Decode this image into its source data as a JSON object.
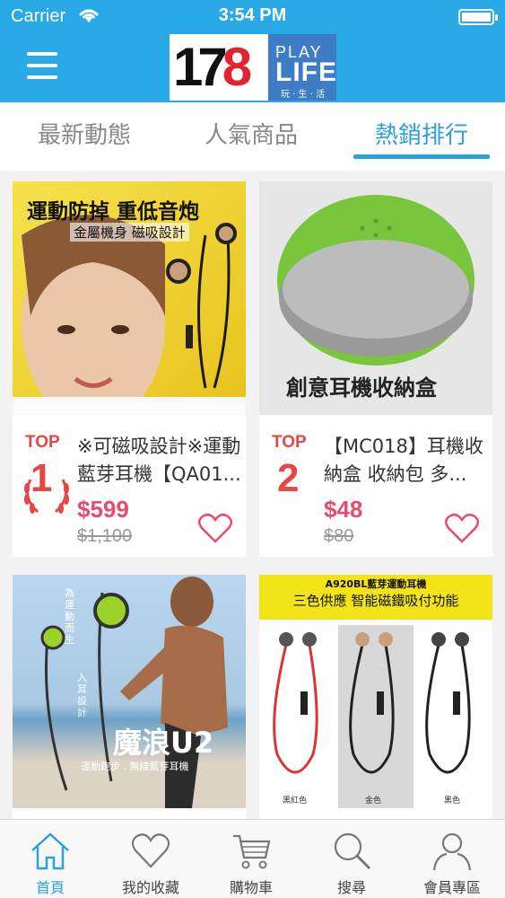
{
  "status_bar": {
    "carrier": "Carrier",
    "time": "3:54 PM",
    "battery_level": 1.0
  },
  "header": {
    "logo": {
      "number_left": "17",
      "number_right": "8",
      "play": "PLAY",
      "life": "LIFE",
      "chinese": "玩 · 生 · 活"
    },
    "icons": {
      "menu": "menu-icon",
      "wifi": "wifi-icon",
      "battery": "battery-icon"
    }
  },
  "tabs": [
    {
      "label": "最新動態",
      "active": false
    },
    {
      "label": "人氣商品",
      "active": false
    },
    {
      "label": "熱銷排行",
      "active": true
    }
  ],
  "products": [
    {
      "rank_label": "TOP",
      "rank": "1",
      "title": "※可磁吸設計※運動藍芽耳機【QA01...",
      "price": "$599",
      "original_price": "$1,100",
      "image_text": {
        "headline": "運動防掉 重低音炮",
        "sub": "金屬機身 磁吸設計"
      }
    },
    {
      "rank_label": "TOP",
      "rank": "2",
      "title": "【MC018】耳機收納盒 收納包 多...",
      "price": "$48",
      "original_price": "$80",
      "image_text": {
        "headline": "創意耳機收納盒"
      }
    },
    {
      "image_text": {
        "brand": "魔浪U2",
        "sub": "運動跑步 . 無線藍芽耳機",
        "vertical1": "為運動而生",
        "vertical2": "入耳設計"
      }
    },
    {
      "image_text": {
        "top": "A920BL藍芽運動耳機",
        "headline": "三色供應  智能磁鐵吸付功能",
        "c1": "黑紅色",
        "c2": "金色",
        "c3": "黑色"
      }
    }
  ],
  "bottom_nav": [
    {
      "label": "首頁",
      "icon": "home-icon",
      "active": true
    },
    {
      "label": "我的收藏",
      "icon": "heart-icon",
      "active": false
    },
    {
      "label": "購物車",
      "icon": "cart-icon",
      "active": false
    },
    {
      "label": "搜尋",
      "icon": "search-icon",
      "active": false
    },
    {
      "label": "會員專區",
      "icon": "user-icon",
      "active": false
    }
  ],
  "colors": {
    "header": "#29a9e5",
    "active": "#2aa0dc",
    "price": "#e84b6b",
    "rank": "#e84545"
  }
}
